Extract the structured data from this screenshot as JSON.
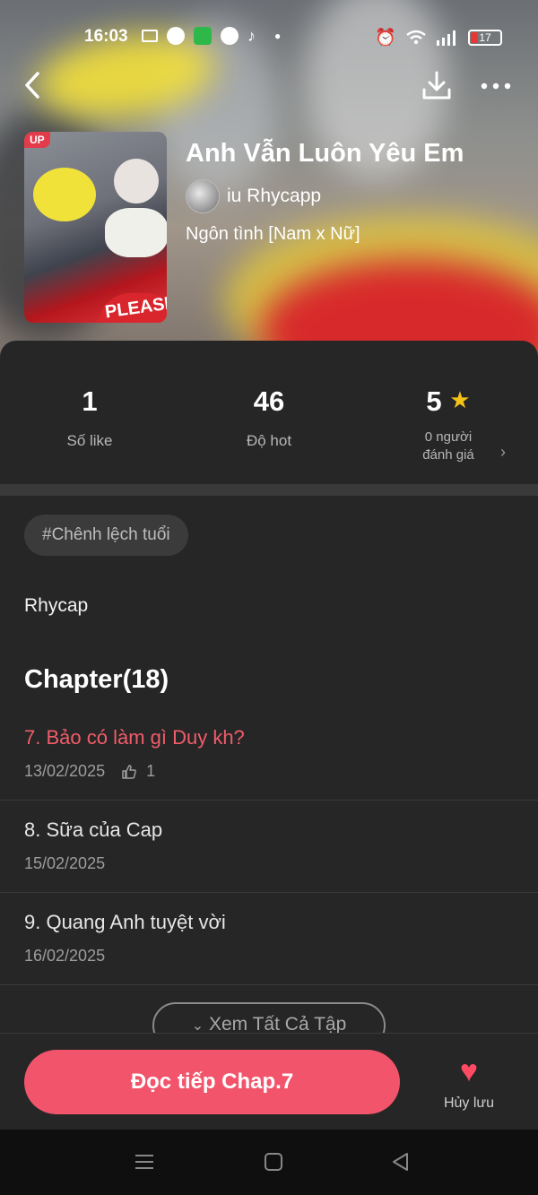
{
  "status_bar": {
    "time": "16:03",
    "battery": "17"
  },
  "book": {
    "title": "Anh Vẫn Luôn Yêu Em",
    "author": "iu Rhycapp",
    "genre": "Ngôn tình [Nam x Nữ]",
    "cover_badge": "UP",
    "cover_text": "PLEASE"
  },
  "stats": {
    "likes_value": "1",
    "likes_label": "Số like",
    "hot_value": "46",
    "hot_label": "Độ hot",
    "rating_value": "5",
    "rating_label_line1": "0 người",
    "rating_label_line2": "đánh giá"
  },
  "tag": "#Chênh lệch tuổi",
  "description": "Rhycap",
  "chapter_header": "Chapter(18)",
  "chapters": [
    {
      "title": "7. Bảo có làm gì Duy kh?",
      "date": "13/02/2025",
      "likes": "1",
      "active": true
    },
    {
      "title": "8. Sữa của Cap",
      "date": "15/02/2025"
    },
    {
      "title": "9. Quang Anh tuyệt vời",
      "date": "16/02/2025"
    }
  ],
  "view_all_label": "Xem Tất Cả Tập",
  "bottom": {
    "read_label": "Đọc tiếp Chap.7",
    "save_label": "Hủy lưu"
  },
  "colors": {
    "accent": "#f2546b",
    "active_chapter": "#f25c6a",
    "star": "#f5c218",
    "heart": "#ff4a63"
  }
}
